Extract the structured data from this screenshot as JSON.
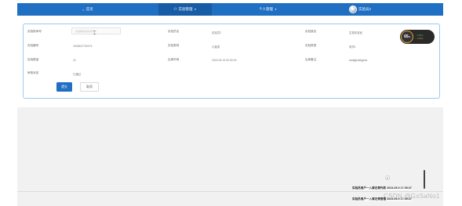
{
  "nav": {
    "home": "首页",
    "experiment": "实验管理",
    "profile": "个人管理",
    "user": "实验员2"
  },
  "form": {
    "fields": [
      {
        "label": "实验房间号",
        "value": "请选择实验房间号"
      },
      {
        "label": "实验员名",
        "value": "实验员2"
      },
      {
        "label": "实验室名",
        "value": "生物实验室"
      },
      {
        "label": "实验编号",
        "value": "1693622740374"
      },
      {
        "label": "实验类别",
        "value": "计量类"
      },
      {
        "label": "实验类型",
        "value": "电学1"
      },
      {
        "label": "实验数量",
        "value": "22"
      },
      {
        "label": "出库时间",
        "value": "2023-09-15 00:00:00"
      },
      {
        "label": "出库备注",
        "value": "asdfgjkdsfgjkds"
      },
      {
        "label": "审核状态",
        "value": "已通过"
      }
    ],
    "submit": "提交",
    "cancel": "取消"
  },
  "gauge": {
    "percent": "65",
    "percent_unit": "%",
    "up": "0.1K/s",
    "down": "0.1K/s"
  },
  "logs": {
    "line1": "实验员用户一入库记录列表 2023-09-9 17:05:37",
    "line2": "实验员用户一入库记录管理 2023-09-9 17:05:37"
  },
  "watermark": "CSDN @GxSaNo1"
}
